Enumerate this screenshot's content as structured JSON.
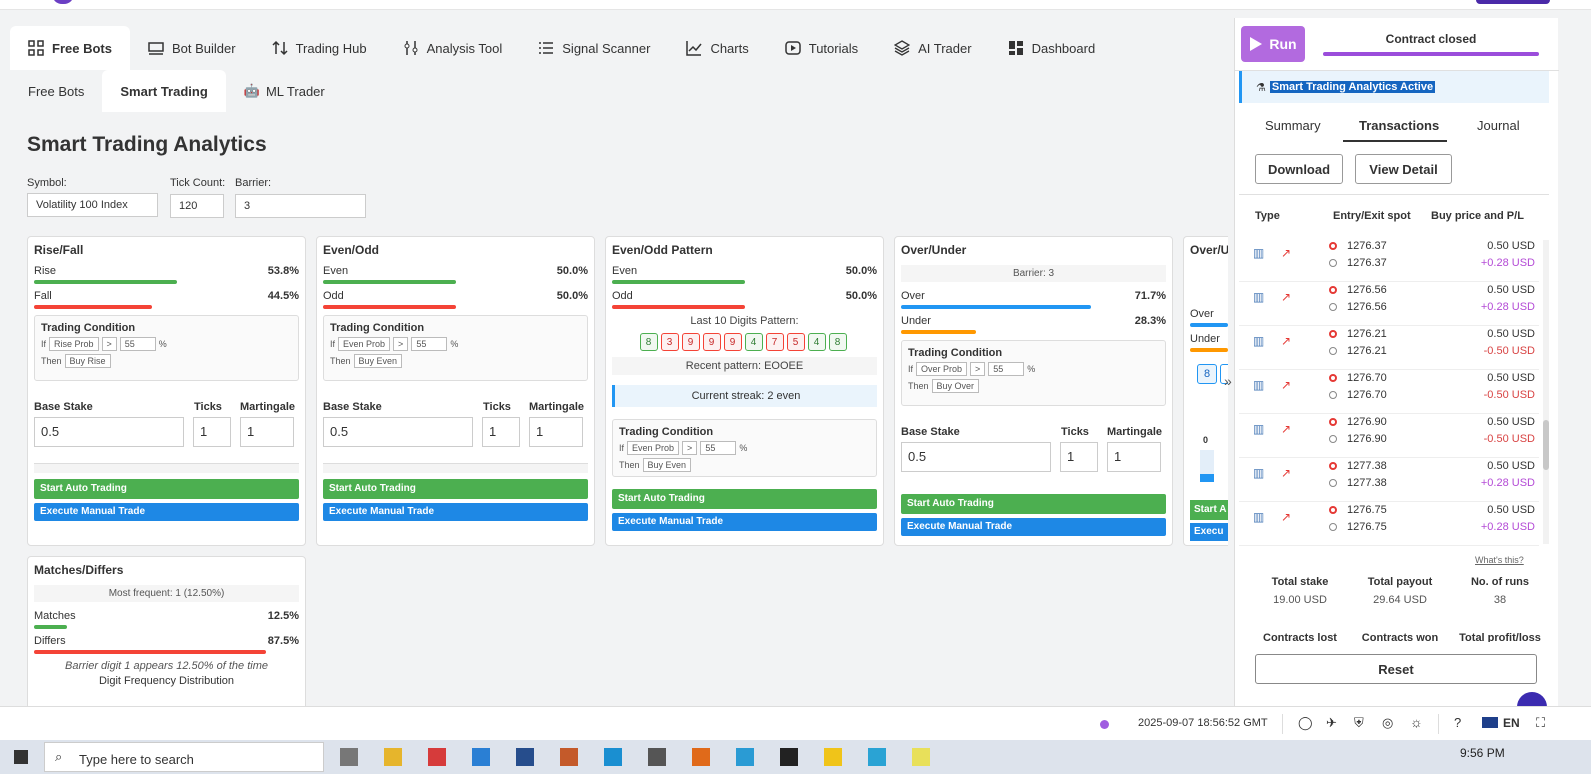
{
  "nav": {
    "tabs": [
      {
        "label": "Free Bots",
        "icon": "grid-icon"
      },
      {
        "label": "Bot Builder",
        "icon": "builder-icon"
      },
      {
        "label": "Trading Hub",
        "icon": "swap-icon"
      },
      {
        "label": "Analysis Tool",
        "icon": "sliders-icon"
      },
      {
        "label": "Signal Scanner",
        "icon": "list-icon"
      },
      {
        "label": "Charts",
        "icon": "chart-icon"
      },
      {
        "label": "Tutorials",
        "icon": "play-icon"
      },
      {
        "label": "AI Trader",
        "icon": "layers-icon"
      },
      {
        "label": "Dashboard",
        "icon": "dashboard-icon"
      }
    ]
  },
  "subnav": {
    "tabs": [
      "Free Bots",
      "Smart Trading",
      "ML Trader"
    ]
  },
  "page": {
    "title": "Smart Trading Analytics",
    "symbol_label": "Symbol:",
    "symbol_value": "Volatility 100 Index",
    "tickcount_label": "Tick Count:",
    "tickcount_value": "120",
    "barrier_label": "Barrier:",
    "barrier_value": "3"
  },
  "common": {
    "trading_condition": "Trading Condition",
    "if": "If",
    "then": "Then",
    "op": ">",
    "threshold": "55",
    "pct": "%",
    "base_stake": "Base Stake",
    "ticks": "Ticks",
    "martingale": "Martingale",
    "stake_value": "0.5",
    "ticks_value": "1",
    "martingale_value": "1",
    "start_auto": "Start Auto Trading",
    "execute_manual": "Execute Manual Trade"
  },
  "cards": {
    "risefall": {
      "title": "Rise/Fall",
      "a_label": "Rise",
      "a_val": "53.8%",
      "a_pct": 53.8,
      "b_label": "Fall",
      "b_val": "44.5%",
      "b_pct": 44.5,
      "cond_field": "Rise Prob",
      "cond_action": "Buy Rise"
    },
    "evenodd": {
      "title": "Even/Odd",
      "a_label": "Even",
      "a_val": "50.0%",
      "a_pct": 50,
      "b_label": "Odd",
      "b_val": "50.0%",
      "b_pct": 50,
      "cond_field": "Even Prob",
      "cond_action": "Buy Even"
    },
    "pattern": {
      "title": "Even/Odd Pattern",
      "a_label": "Even",
      "a_val": "50.0%",
      "a_pct": 50,
      "b_label": "Odd",
      "b_val": "50.0%",
      "b_pct": 50,
      "pattern_label": "Last 10 Digits Pattern:",
      "digits": [
        "8",
        "3",
        "9",
        "9",
        "9",
        "4",
        "7",
        "5",
        "4",
        "8"
      ],
      "recent": "Recent pattern: EOOEE",
      "streak": "Current streak: 2 even",
      "cond_field": "Even Prob",
      "cond_action": "Buy Even"
    },
    "overunder": {
      "title": "Over/Under",
      "barrier": "Barrier: 3",
      "a_label": "Over",
      "a_val": "71.7%",
      "a_pct": 71.7,
      "b_label": "Under",
      "b_val": "28.3%",
      "b_pct": 28.3,
      "cond_field": "Over Prob",
      "cond_action": "Buy Over"
    },
    "overunder2": {
      "title": "Over/U",
      "a_label": "Over",
      "b_label": "Under",
      "digit": "8",
      "zero": "0",
      "start": "Start A",
      "exec": "Execu"
    },
    "matches": {
      "title": "Matches/Differs",
      "most": "Most frequent: 1 (12.50%)",
      "a_label": "Matches",
      "a_val": "12.5%",
      "a_pct": 12.5,
      "b_label": "Differs",
      "b_val": "87.5%",
      "b_pct": 87.5,
      "note": "Barrier digit 1 appears 12.50% of the time",
      "dist": "Digit Frequency Distribution"
    }
  },
  "rpanel": {
    "run": "Run",
    "status": "Contract closed",
    "banner": "Smart Trading Analytics Active",
    "tabs": [
      "Summary",
      "Transactions",
      "Journal"
    ],
    "download": "Download",
    "view_detail": "View Detail",
    "cols": [
      "Type",
      "Entry/Exit spot",
      "Buy price and P/L"
    ],
    "rows": [
      {
        "entry": "1276.37",
        "exit": "1276.37",
        "price": "0.50 USD",
        "pl": "+0.28 USD"
      },
      {
        "entry": "1276.56",
        "exit": "1276.56",
        "price": "0.50 USD",
        "pl": "+0.28 USD"
      },
      {
        "entry": "1276.21",
        "exit": "1276.21",
        "price": "0.50 USD",
        "pl": "-0.50 USD"
      },
      {
        "entry": "1276.70",
        "exit": "1276.70",
        "price": "0.50 USD",
        "pl": "-0.50 USD"
      },
      {
        "entry": "1276.90",
        "exit": "1276.90",
        "price": "0.50 USD",
        "pl": "-0.50 USD"
      },
      {
        "entry": "1277.38",
        "exit": "1277.38",
        "price": "0.50 USD",
        "pl": "+0.28 USD"
      },
      {
        "entry": "1276.75",
        "exit": "1276.75",
        "price": "0.50 USD",
        "pl": "+0.28 USD"
      }
    ],
    "whats_this": "What's this?",
    "totals": [
      {
        "label": "Total stake",
        "value": "19.00 USD"
      },
      {
        "label": "Total payout",
        "value": "29.64 USD"
      },
      {
        "label": "No. of runs",
        "value": "38"
      }
    ],
    "totals2": [
      "Contracts lost",
      "Contracts won",
      "Total profit/loss"
    ],
    "reset": "Reset"
  },
  "statusbar": {
    "datetime": "2025-09-07 18:56:52 GMT",
    "lang": "EN"
  },
  "taskbar": {
    "search": "Type here to search",
    "time": "9:56 PM"
  }
}
